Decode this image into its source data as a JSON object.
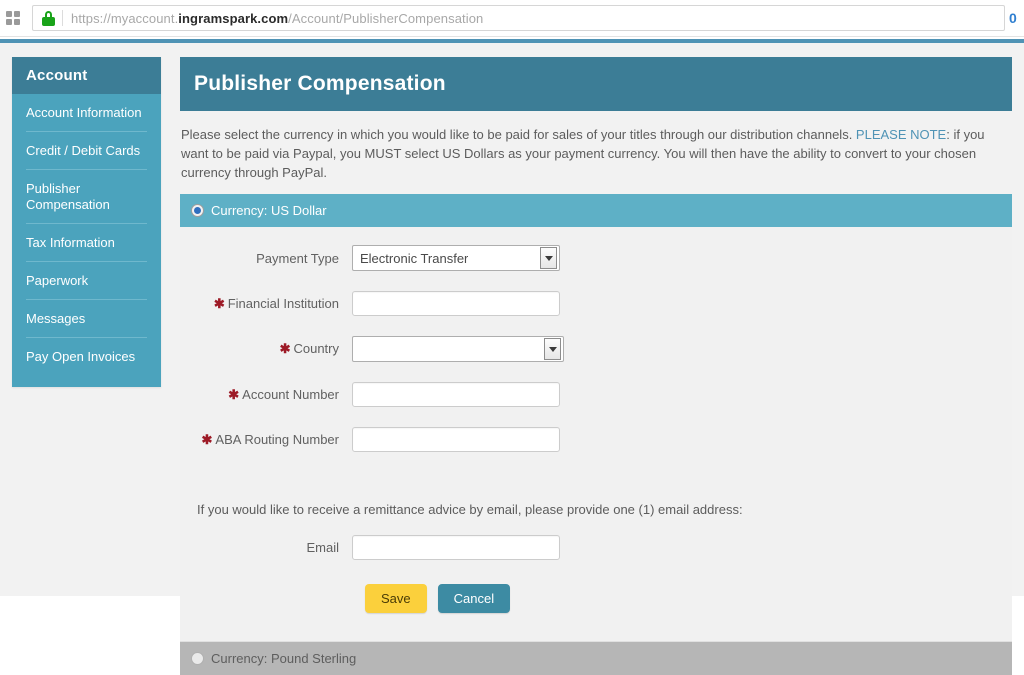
{
  "browser": {
    "apps_icon": "grid-apps-icon",
    "lock_icon": "padlock-secure-icon",
    "url_scheme": "https://myaccount.",
    "url_domain": "ingramspark.com",
    "url_path": "/Account/PublisherCompensation",
    "right_text": "0"
  },
  "sidebar": {
    "title": "Account",
    "items": [
      {
        "label": "Account Information"
      },
      {
        "label": "Credit / Debit Cards"
      },
      {
        "label": "Publisher Compensation"
      },
      {
        "label": "Tax Information"
      },
      {
        "label": "Paperwork"
      },
      {
        "label": "Messages"
      },
      {
        "label": "Pay Open Invoices"
      }
    ]
  },
  "main": {
    "page_title": "Publisher Compensation",
    "intro_part1": "Please select the currency in which you would like to be paid for sales of your titles through our distribution channels. ",
    "intro_note": "PLEASE NOTE",
    "intro_part2": ": if you want to be paid via Paypal, you MUST select US Dollars as your payment currency. You will then have the ability to convert to your chosen currency through PayPal.",
    "currency_usd_label": "Currency: US Dollar",
    "currency_gbp_label": "Currency: Pound Sterling",
    "form": {
      "payment_type_label": "Payment Type",
      "payment_type_value": "Electronic Transfer",
      "financial_institution_label": "Financial Institution",
      "financial_institution_value": "",
      "country_label": "Country",
      "country_value": "",
      "account_number_label": "Account Number",
      "account_number_value": "",
      "aba_routing_label": "ABA Routing Number",
      "aba_routing_value": "",
      "required_marker": "✱",
      "remittance_text": "If you would like to receive a remittance advice by email, please provide one (1) email address:",
      "email_label": "Email",
      "email_value": "",
      "save_label": "Save",
      "cancel_label": "Cancel"
    }
  },
  "colors": {
    "header_teal": "#3c7d96",
    "sidebar_teal": "#4ba3bd",
    "currency_active": "#5eb0c6",
    "currency_inactive": "#b6b6b6",
    "save_yellow": "#fbd03c",
    "cancel_teal": "#3d8ba3",
    "required_red": "#9d1a26",
    "link_blue": "#4f93b5"
  }
}
